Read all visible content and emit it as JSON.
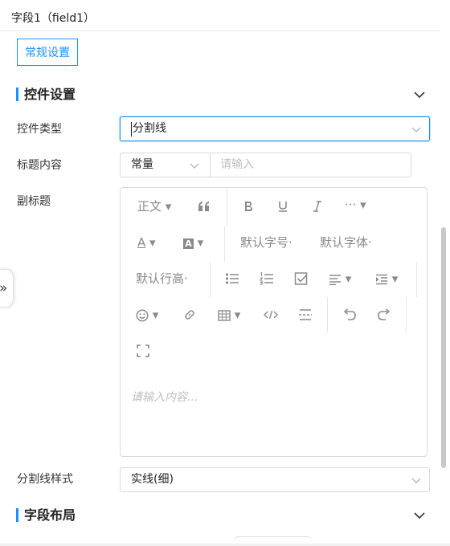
{
  "header": {
    "title": "字段1（field1）"
  },
  "general_settings_button": "常规设置",
  "control_section": {
    "title": "控件设置"
  },
  "control_type": {
    "label": "控件类型",
    "value": "分割线"
  },
  "title_content": {
    "label": "标题内容",
    "mode": "常量",
    "placeholder": "请输入"
  },
  "subtitle": {
    "label": "副标题",
    "toolbar": {
      "paragraph": "正文",
      "font_size": "默认字号",
      "font_family": "默认字体",
      "line_height": "默认行高"
    },
    "placeholder": "请输入内容..."
  },
  "divider_style": {
    "label": "分割线样式",
    "value": "实线(细)"
  },
  "layout_section": {
    "title": "字段布局"
  },
  "icons": [
    "expand-panel-icon",
    "chevron-down-icon",
    "quote-icon",
    "bold-icon",
    "underline-icon",
    "italic-icon",
    "more-icon",
    "font-color-icon",
    "background-color-icon",
    "bulleted-list-icon",
    "numbered-list-icon",
    "todo-list-icon",
    "align-icon",
    "indent-icon",
    "emoji-icon",
    "link-icon",
    "table-icon",
    "code-icon",
    "divider-icon",
    "undo-icon",
    "redo-icon",
    "fullscreen-icon"
  ],
  "colors": {
    "accent": "#1890ff",
    "border": "#d9d9d9",
    "icon": "#8a8a8a"
  }
}
